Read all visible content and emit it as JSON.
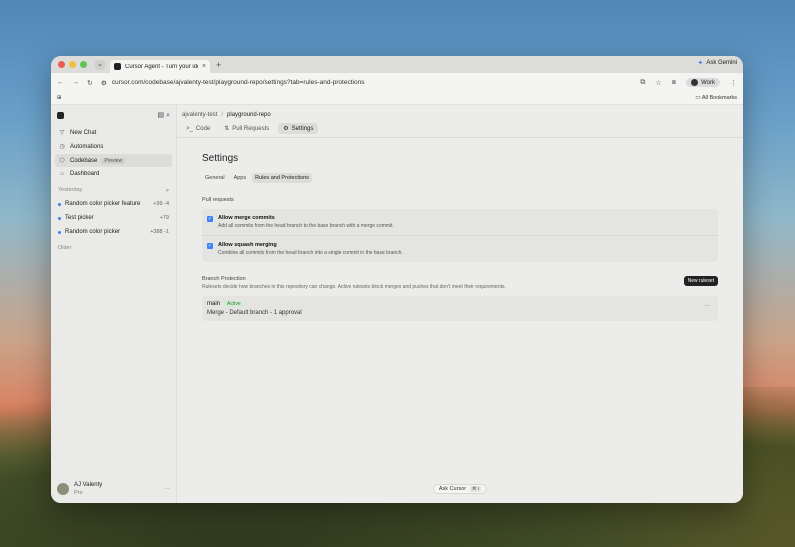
{
  "browser": {
    "tab_title": "Cursor Agent - Turn your ide",
    "ask_gemini": "Ask Gemini",
    "url": "cursor.com/codebase/ajvalenty-test/playground-repo/settings?tab=rules-and-protections",
    "profile": "Work",
    "all_bookmarks": "All Bookmarks"
  },
  "sidebar": {
    "items": [
      {
        "label": "New Chat",
        "icon": "new-chat-icon"
      },
      {
        "label": "Automations",
        "icon": "automations-icon"
      },
      {
        "label": "Codebase",
        "icon": "codebase-icon",
        "badge": "Preview",
        "active": true
      },
      {
        "label": "Dashboard",
        "icon": "dashboard-icon"
      }
    ],
    "section_yesterday": "Yesterday",
    "chats": [
      {
        "label": "Random color picker feature",
        "stat": "+99 -4"
      },
      {
        "label": "Test picker",
        "stat": "+79"
      },
      {
        "label": "Random color picker",
        "stat": "+388 -1"
      }
    ],
    "section_older": "Older",
    "user": {
      "name": "AJ Valenty",
      "plan": "Pro"
    }
  },
  "main": {
    "breadcrumb": {
      "org": "ajvalenty-test",
      "repo": "playground-repo"
    },
    "tabs": [
      {
        "label": "Code",
        "icon": ">_"
      },
      {
        "label": "Pull Requests",
        "icon": "⇅"
      },
      {
        "label": "Settings",
        "icon": "⚙"
      }
    ],
    "title": "Settings",
    "subtabs": [
      "General",
      "Apps",
      "Rules and Protections"
    ],
    "pull_requests_label": "Pull requests",
    "options": [
      {
        "title": "Allow merge commits",
        "desc": "Add all commits from the head branch to the base branch with a merge commit."
      },
      {
        "title": "Allow squash merging",
        "desc": "Combine all commits from the head branch into a single commit in the base branch."
      }
    ],
    "branch_protection": {
      "title": "Branch Protection",
      "desc": "Rulesets decide how branches in this repository can change. Active rulesets block merges and pushes that don't meet their requirements.",
      "new_ruleset": "New ruleset",
      "rule": {
        "name": "main",
        "status": "Active",
        "summary": "Merge - Default branch - 1 approval"
      }
    },
    "ask_cursor": {
      "label": "Ask Cursor",
      "shortcut": "⌘ I"
    }
  }
}
